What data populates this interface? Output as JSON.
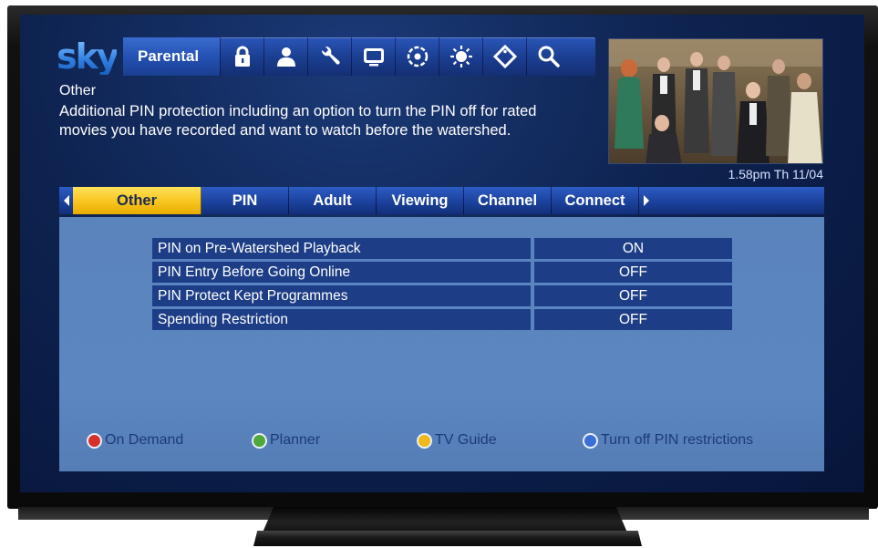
{
  "menu": {
    "logo": "sky",
    "section_label": "Parental",
    "icons": [
      "lock-icon",
      "person-icon",
      "wrench-icon",
      "tv-icon",
      "disc-icon",
      "sun-icon",
      "tag-icon",
      "search-icon"
    ]
  },
  "header": {
    "title": "Other",
    "description": "Additional PIN protection including an option to turn the PIN off for rated movies you have recorded and want to watch before the watershed.",
    "clock": "1.58pm Th 11/04"
  },
  "tabs": [
    {
      "label": "Other",
      "active": true
    },
    {
      "label": "PIN",
      "active": false
    },
    {
      "label": "Adult",
      "active": false
    },
    {
      "label": "Viewing",
      "active": false
    },
    {
      "label": "Channel",
      "active": false
    },
    {
      "label": "Connect",
      "active": false
    }
  ],
  "settings": [
    {
      "label": "PIN on Pre-Watershed Playback",
      "value": "ON"
    },
    {
      "label": "PIN Entry Before Going Online",
      "value": "OFF"
    },
    {
      "label": "PIN Protect Kept Programmes",
      "value": "OFF"
    },
    {
      "label": "Spending Restriction",
      "value": "OFF"
    }
  ],
  "footer": [
    {
      "label": "On Demand",
      "color": "#d8302a"
    },
    {
      "label": "Planner",
      "color": "#4ea83a"
    },
    {
      "label": "TV Guide",
      "color": "#f0b81a"
    },
    {
      "label": "Turn off PIN restrictions",
      "color": "#3a6fd8"
    }
  ]
}
